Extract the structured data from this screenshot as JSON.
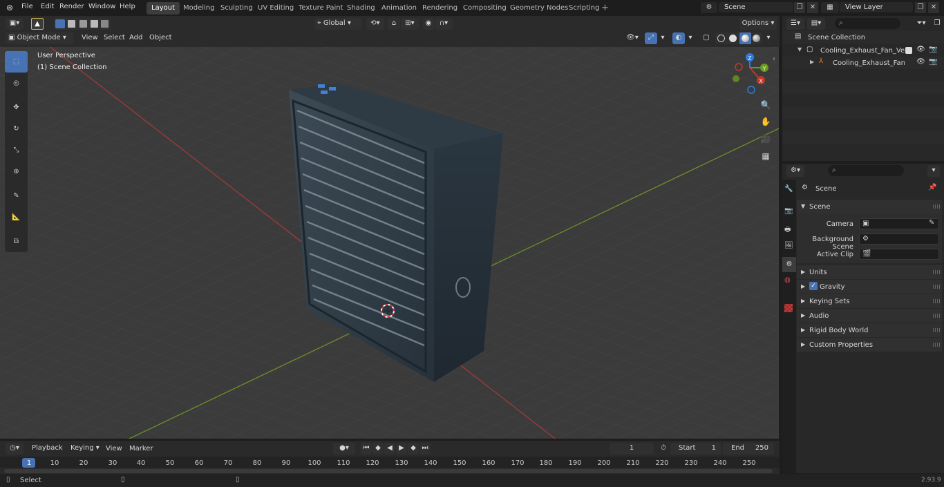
{
  "menubar": {
    "items": [
      "File",
      "Edit",
      "Render",
      "Window",
      "Help"
    ],
    "workspaces": [
      "Layout",
      "Modeling",
      "Sculpting",
      "UV Editing",
      "Texture Paint",
      "Shading",
      "Animation",
      "Rendering",
      "Compositing",
      "Geometry Nodes",
      "Scripting"
    ],
    "active_workspace": "Layout",
    "scene_name": "Scene",
    "view_layer": "View Layer"
  },
  "viewport_header": {
    "transform_orientation": "Global",
    "options_label": "Options",
    "mode": "Object Mode",
    "menus": [
      "View",
      "Select",
      "Add",
      "Object"
    ]
  },
  "viewport": {
    "perspective_label": "User Perspective",
    "collection_label": "(1) Scene Collection",
    "gizmo_axes": [
      "Z",
      "Y",
      "X"
    ]
  },
  "outliner": {
    "root": "Scene Collection",
    "items": [
      {
        "label": "Cooling_Exhaust_Fan_Vent_C"
      },
      {
        "label": "Cooling_Exhaust_Fan_Ve"
      }
    ]
  },
  "properties": {
    "context_title": "Scene",
    "panel_title": "Scene",
    "fields": [
      {
        "label": "Camera"
      },
      {
        "label": "Background Scene"
      },
      {
        "label": "Active Clip"
      }
    ],
    "subpanels": [
      "Units",
      "Gravity",
      "Keying Sets",
      "Audio",
      "Rigid Body World",
      "Custom Properties"
    ]
  },
  "timeline": {
    "menus": [
      "Playback",
      "Keying",
      "View",
      "Marker"
    ],
    "current_frame": "1",
    "start_label": "Start",
    "start_value": "1",
    "end_label": "End",
    "end_value": "250",
    "ruler": [
      "1",
      "10",
      "20",
      "30",
      "40",
      "50",
      "60",
      "70",
      "80",
      "90",
      "100",
      "110",
      "120",
      "130",
      "140",
      "150",
      "160",
      "170",
      "180",
      "190",
      "200",
      "210",
      "220",
      "230",
      "240",
      "250"
    ]
  },
  "statusbar": {
    "left_action": "Select",
    "version": "2.93.9"
  },
  "colors": {
    "accent": "#4772b3",
    "x_axis": "#c0392b",
    "y_axis": "#6a9a1f",
    "z_axis": "#2d7de0"
  }
}
